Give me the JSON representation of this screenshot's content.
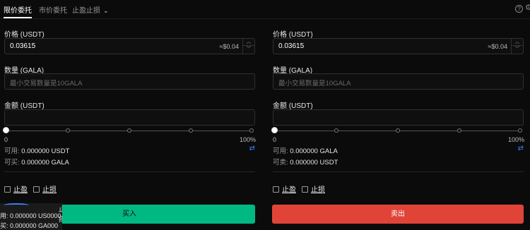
{
  "tabs": {
    "limit": "限价委托",
    "market": "市价委托",
    "tpsl": "止盈止损",
    "tpsl_chevron": "chevron-down-icon"
  },
  "header_icons": {
    "help": "?",
    "settings": "⚙"
  },
  "buy": {
    "price_label": "价格 (USDT)",
    "price_value": "0.03615",
    "price_approx": "≈$0.04",
    "qty_label": "数量 (GALA)",
    "qty_placeholder": "最小交易数量是10GALA",
    "amount_label": "金额 (USDT)",
    "slider_min": "0",
    "slider_max": "100%",
    "slider_value": 0,
    "avail_label": "可用: ",
    "avail_value": "0.000000 USDT",
    "can_buy_label": "可买: ",
    "can_buy_value": "0.000000 GALA",
    "tp_label": "止盈",
    "sl_label": "止损",
    "button_label": "买入"
  },
  "sell": {
    "price_label": "价格 (USDT)",
    "price_value": "0.03615",
    "price_approx": "≈$0.04",
    "qty_label": "数量 (GALA)",
    "qty_placeholder": "最小交易数量是10GALA",
    "amount_label": "金额 (USDT)",
    "slider_min": "0",
    "slider_max": "100%",
    "slider_value": 0,
    "avail_label": "可用: ",
    "avail_value": "0.000000 GALA",
    "can_sell_label": "可卖: ",
    "can_sell_value": "0.000000 USDT",
    "tp_label": "止盈",
    "sl_label": "止损",
    "button_label": "卖出"
  },
  "overlay": {
    "line1": "用: 0.000000 US0000",
    "line2": "买: 0.000000 GA000",
    "stop_text": "止损"
  },
  "colors": {
    "buy": "#00b982",
    "sell": "#e04438",
    "accent": "#3b82f6",
    "background": "#0b0b0b"
  }
}
